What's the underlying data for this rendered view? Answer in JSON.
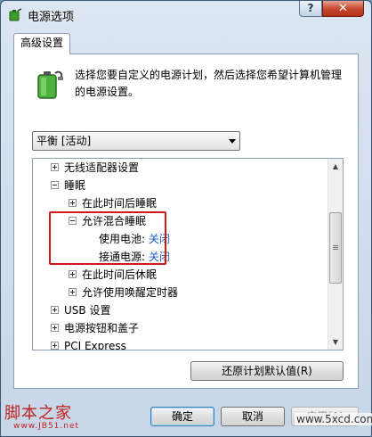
{
  "window": {
    "title": "电源选项",
    "help_label": "?",
    "close_label": "✕"
  },
  "tab": {
    "label": "高级设置"
  },
  "description": "选择您要自定义的电源计划，然后选择您希望计算机管理的电源设置。",
  "plan_select": {
    "value": "平衡 [活动]"
  },
  "tree": {
    "items": [
      {
        "label": "无线适配器设置"
      },
      {
        "label": "睡眠"
      },
      {
        "label": "在此时间后睡眠"
      },
      {
        "label": "允许混合睡眠"
      },
      {
        "label": "使用电池:",
        "value": "关闭"
      },
      {
        "label": "接通电源:",
        "value": "关闭"
      },
      {
        "label": "在此时间后休眠"
      },
      {
        "label": "允许使用唤醒定时器"
      },
      {
        "label": "USB 设置"
      },
      {
        "label": "电源按钮和盖子"
      },
      {
        "label": "PCI Express"
      }
    ]
  },
  "buttons": {
    "restore_defaults": "还原计划默认值(R)",
    "ok": "确定",
    "cancel": "取消",
    "apply": "应用(A)"
  },
  "watermarks": {
    "left": "脚本之家",
    "left_sub": "www.JB51.net",
    "right": "www.5xcd.com"
  },
  "colors": {
    "link_value": "#1a5bbf",
    "highlight_border": "#d21818",
    "watermark": "#c21f1f"
  }
}
